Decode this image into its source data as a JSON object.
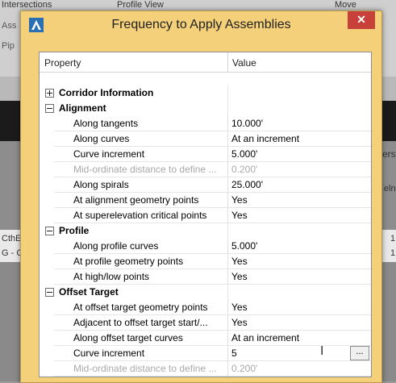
{
  "background": {
    "ribbon_items": [
      "Intersections",
      "Profile View",
      "Move"
    ],
    "left_cut_labels": [
      "Ass",
      "Pip"
    ],
    "list_text": [
      "CthE",
      "G - C"
    ],
    "right_cut_labels": [
      "ers",
      "eln",
      "1",
      "1"
    ]
  },
  "dialog": {
    "title": "Frequency to Apply Assemblies",
    "close_glyph": "✕",
    "columns": {
      "property": "Property",
      "value": "Value"
    },
    "sections": [
      {
        "key": "corridor",
        "label": "Corridor Information",
        "expanded": false,
        "rows": []
      },
      {
        "key": "alignment",
        "label": "Alignment",
        "expanded": true,
        "rows": [
          {
            "label": "Along tangents",
            "value": "10.000'",
            "disabled": false
          },
          {
            "label": "Along curves",
            "value": "At an increment",
            "disabled": false
          },
          {
            "label": "Curve increment",
            "value": "5.000'",
            "disabled": false
          },
          {
            "label": "Mid-ordinate distance to define ...",
            "value": "0.200'",
            "disabled": true
          },
          {
            "label": "Along spirals",
            "value": "25.000'",
            "disabled": false
          },
          {
            "label": "At alignment geometry points",
            "value": "Yes",
            "disabled": false
          },
          {
            "label": "At superelevation critical points",
            "value": "Yes",
            "disabled": false
          }
        ]
      },
      {
        "key": "profile",
        "label": "Profile",
        "expanded": true,
        "rows": [
          {
            "label": "Along profile curves",
            "value": "5.000'",
            "disabled": false
          },
          {
            "label": "At profile geometry points",
            "value": "Yes",
            "disabled": false
          },
          {
            "label": "At high/low points",
            "value": "Yes",
            "disabled": false
          }
        ]
      },
      {
        "key": "offset",
        "label": "Offset Target",
        "expanded": true,
        "rows": [
          {
            "label": "At offset target geometry points",
            "value": "Yes",
            "disabled": false
          },
          {
            "label": "Adjacent to offset target start/...",
            "value": "Yes",
            "disabled": false
          },
          {
            "label": "Along offset target curves",
            "value": "At an increment",
            "disabled": false
          },
          {
            "label": "Curve increment",
            "value": "5",
            "disabled": false,
            "editing": true,
            "button": "..."
          },
          {
            "label": "Mid-ordinate distance to define ...",
            "value": "0.200'",
            "disabled": true
          }
        ]
      }
    ]
  },
  "colors": {
    "dialog_frame": "#f4d07a",
    "close_button": "#c7413a",
    "disabled_text": "#a9a9a9"
  }
}
